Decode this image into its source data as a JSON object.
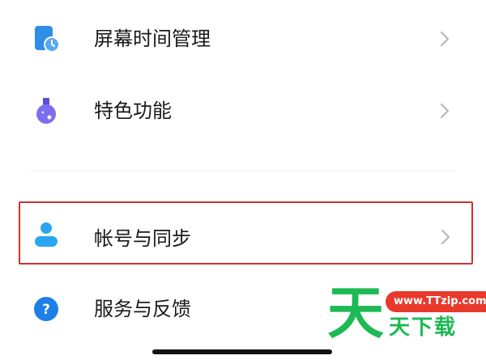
{
  "menu": {
    "items": [
      {
        "label": "屏幕时间管理",
        "icon": "hourglass-phone-icon"
      },
      {
        "label": "特色功能",
        "icon": "flask-icon"
      },
      {
        "label": "帐号与同步",
        "icon": "person-icon"
      },
      {
        "label": "服务与反馈",
        "icon": "question-icon"
      }
    ]
  },
  "watermark": {
    "big_char": "天",
    "site": "www.TTzip.com",
    "text": "天下载"
  },
  "colors": {
    "highlight_border": "#c9332f",
    "screen_time_icon": "#2e8ee8",
    "features_icon": "#7d6ef0",
    "account_icon": "#2aa6f0",
    "service_icon": "#1e7fe8",
    "watermark_green": "#1db954",
    "watermark_red": "#e8392c"
  }
}
